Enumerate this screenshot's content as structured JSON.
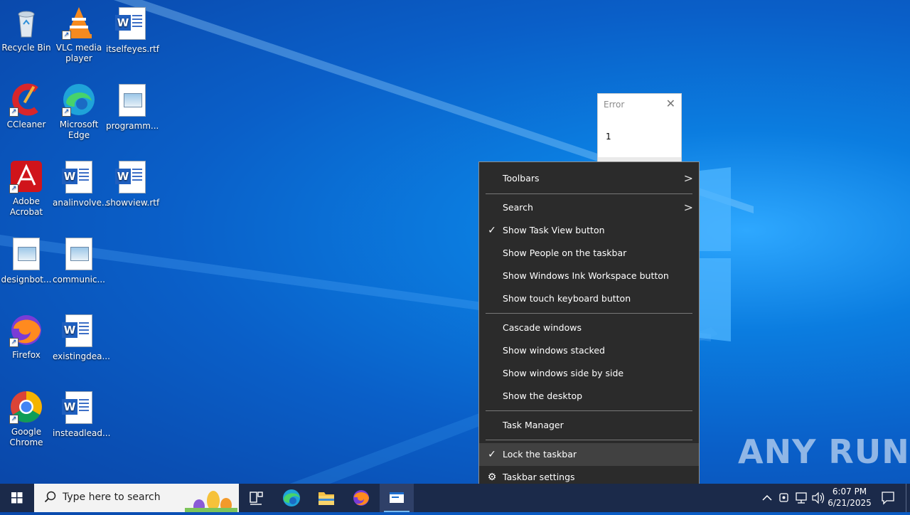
{
  "desktop_icons": [
    {
      "label": "Recycle Bin",
      "icon": "recycle-bin-icon"
    },
    {
      "label": "VLC media player",
      "icon": "vlc-icon"
    },
    {
      "label": "itselfeyes.rtf",
      "icon": "word-doc-icon"
    },
    {
      "label": "CCleaner",
      "icon": "ccleaner-icon"
    },
    {
      "label": "Microsoft Edge",
      "icon": "edge-icon"
    },
    {
      "label": "programm...",
      "icon": "image-file-icon"
    },
    {
      "label": "Adobe Acrobat",
      "icon": "acrobat-icon"
    },
    {
      "label": "analinvolve...",
      "icon": "word-doc-icon"
    },
    {
      "label": "showview.rtf",
      "icon": "word-doc-icon"
    },
    {
      "label": "designbot...",
      "icon": "image-file-icon"
    },
    {
      "label": "communic...",
      "icon": "image-file-icon"
    },
    {
      "label": "Firefox",
      "icon": "firefox-icon"
    },
    {
      "label": "existingdea...",
      "icon": "word-doc-icon"
    },
    {
      "label": "Google Chrome",
      "icon": "chrome-icon"
    },
    {
      "label": "insteadlead...",
      "icon": "word-doc-icon"
    }
  ],
  "error_dialog": {
    "title": "Error",
    "message": "1"
  },
  "context_menu": {
    "items": [
      {
        "label": "Toolbars",
        "submenu": true,
        "checked": false
      },
      {
        "label": "Search",
        "submenu": true,
        "checked": false
      },
      {
        "label": "Show Task View button",
        "submenu": false,
        "checked": true
      },
      {
        "label": "Show People on the taskbar",
        "submenu": false,
        "checked": false
      },
      {
        "label": "Show Windows Ink Workspace button",
        "submenu": false,
        "checked": false
      },
      {
        "label": "Show touch keyboard button",
        "submenu": false,
        "checked": false
      },
      {
        "label": "Cascade windows",
        "submenu": false,
        "checked": false
      },
      {
        "label": "Show windows stacked",
        "submenu": false,
        "checked": false
      },
      {
        "label": "Show windows side by side",
        "submenu": false,
        "checked": false
      },
      {
        "label": "Show the desktop",
        "submenu": false,
        "checked": false
      },
      {
        "label": "Task Manager",
        "submenu": false,
        "checked": false
      },
      {
        "label": "Lock the taskbar",
        "submenu": false,
        "checked": true,
        "highlighted": true
      },
      {
        "label": "Taskbar settings",
        "submenu": false,
        "icon": "gear-icon"
      }
    ]
  },
  "watermark": "ANY RUN",
  "taskbar": {
    "search_placeholder": "Type here to search",
    "apps": [
      "task-view",
      "microsoft-edge",
      "file-explorer",
      "firefox",
      "active-window"
    ],
    "clock_time": "6:07 PM",
    "clock_date": "6/21/2025"
  },
  "colors": {
    "menu_bg": "#2b2b2b",
    "menu_highlight": "#414141",
    "taskbar_bg": "#1b2a4a",
    "desktop_blue": "#0a5fc8"
  }
}
